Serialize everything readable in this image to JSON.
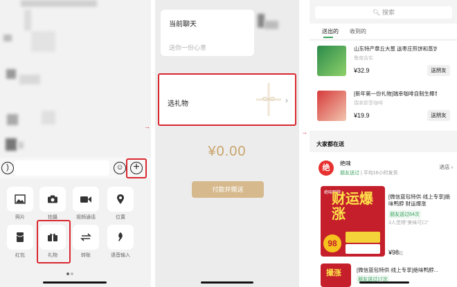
{
  "panel1": {
    "tools_row1": [
      {
        "label": "照片",
        "icon": "image-icon"
      },
      {
        "label": "拍摄",
        "icon": "camera-icon"
      },
      {
        "label": "视频通话",
        "icon": "video-icon"
      },
      {
        "label": "位置",
        "icon": "location-icon"
      }
    ],
    "tools_row2": [
      {
        "label": "红包",
        "icon": "red-envelope-icon"
      },
      {
        "label": "礼物",
        "icon": "gift-icon"
      },
      {
        "label": "转账",
        "icon": "transfer-icon"
      },
      {
        "label": "语音输入",
        "icon": "mic-icon"
      }
    ]
  },
  "panel2": {
    "chat_title": "当前聊天",
    "wish_placeholder": "送你一份心意",
    "select_gift": "选礼物",
    "amount": "¥0.00",
    "pay_button": "付款并赠送"
  },
  "panel3": {
    "search_placeholder": "搜索",
    "tabs": [
      "送出的",
      "收到的"
    ],
    "products": [
      {
        "name": "山东特产章丘大葱 送枣庄煎饼和蒸饼",
        "shop": "鲁南吉实",
        "price": "¥32.9",
        "action": "送朋友"
      },
      {
        "name": "[新年第一份礼物]瑞幸咖啡自制生椰拿铁",
        "shop": "瑞幸即享咖啡",
        "price": "¥19.9",
        "action": "送朋友"
      }
    ],
    "section_title": "大家都在送",
    "store": {
      "logo_char": "绝",
      "name": "绝味",
      "sent_label": "朋友送过",
      "delivery": "平均16小时发货",
      "enter": "进店"
    },
    "featured": {
      "name": "[微信蓝包特供·线上专享]绝味鸭脖 财运爆涨",
      "sent": "朋友送过64次",
      "likes": "3人觉得\"美味可口\"",
      "price": "¥98",
      "price_suffix": "起",
      "img_text": "财运爆涨",
      "img_badge": "绝味鸭脖",
      "img_price": "98"
    },
    "second": {
      "name": "[微信蓝包特供·线上专享]绝味鸭脖...",
      "sent": "朋友送过17次",
      "img_text": "撮涨"
    }
  },
  "colors": {
    "highlight": "#d9262e",
    "gold": "#c8a46a",
    "green": "#39a35d"
  }
}
